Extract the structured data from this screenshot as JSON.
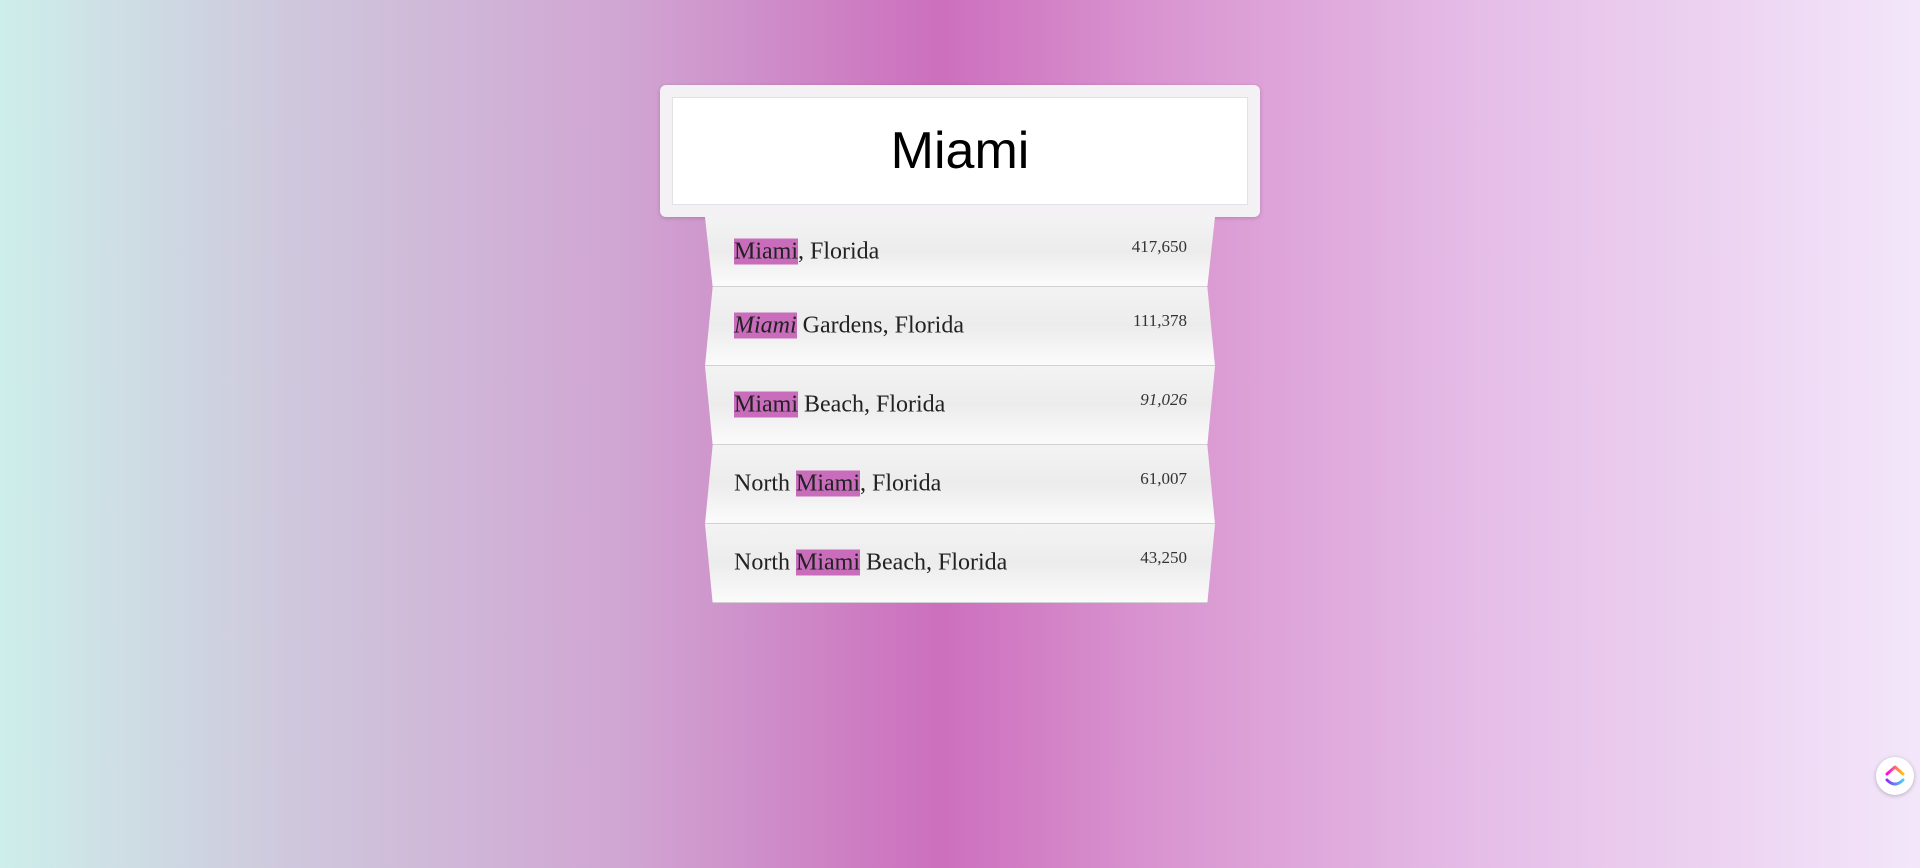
{
  "search": {
    "value": "Miami",
    "placeholder": ""
  },
  "results": [
    {
      "prefix": "",
      "match": "Miami",
      "suffix": ", Florida",
      "population": "417,650",
      "italic": false
    },
    {
      "prefix": "",
      "match": "Miami",
      "suffix": " Gardens, Florida",
      "population": "111,378",
      "italic": true
    },
    {
      "prefix": "",
      "match": "Miami",
      "suffix": " Beach, Florida",
      "population": "91,026",
      "italic": false
    },
    {
      "prefix": "North ",
      "match": "Miami",
      "suffix": ", Florida",
      "population": "61,007",
      "italic": false
    },
    {
      "prefix": "North ",
      "match": "Miami",
      "suffix": " Beach, Florida",
      "population": "43,250",
      "italic": false
    }
  ],
  "colors": {
    "highlight": "#c96cbb",
    "accent_left": "#cdeeea",
    "accent_mid": "#cc6fbd",
    "accent_right": "#f3e6fa"
  },
  "widget": {
    "icon": "clickup-logo-icon"
  }
}
